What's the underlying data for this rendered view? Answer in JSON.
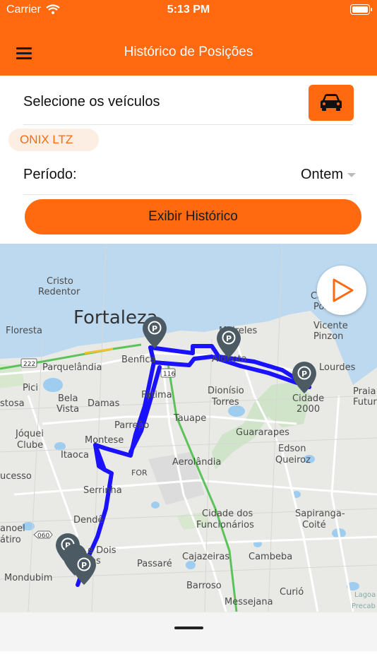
{
  "status_bar": {
    "carrier": "Carrier",
    "time": "5:13 PM"
  },
  "header": {
    "title": "Histórico de Posições",
    "menu_icon": "hamburger-menu-icon",
    "color": "#ff6a10"
  },
  "vehicles": {
    "label": "Selecione os veículos",
    "button_icon": "car-icon",
    "selected_chip": "ONIX LTZ"
  },
  "period": {
    "label": "Período:",
    "value": "Ontem"
  },
  "action": {
    "label": "Exibir Histórico"
  },
  "map": {
    "route_color": "#1a12ff",
    "labels": {
      "cristo_redentor": [
        "Cristo",
        "Redentor"
      ],
      "fortaleza": "Fortaleza",
      "floresta": "Floresta",
      "parquelandia": "Parquelândia",
      "benfica": "Benfica",
      "meireles": "Meireles",
      "aldeota": "Aldeota",
      "cais_porto": [
        "Cais do",
        "Porto"
      ],
      "vicente_pinzon": [
        "Vicente",
        "Pinzon"
      ],
      "de_lourdes": "Lourdes",
      "praia_futuro": [
        "Praia",
        "Futur"
      ],
      "pici": "Pici",
      "bela_vista": [
        "Bela",
        "Vista"
      ],
      "damas": "Damas",
      "fatima": "Fátima",
      "dionisio_torres": [
        "Dionísio",
        "Torres"
      ],
      "cidade_2000": [
        "Cidade",
        "2000"
      ],
      "costa": "stosa",
      "joquei_clube": [
        "Jóquei",
        "Clube"
      ],
      "parreao": "Parreão",
      "tauape": "Tauape",
      "guararapes": "Guararapes",
      "montese": "Montese",
      "edson_queiroz": [
        "Edson",
        "Queiroz"
      ],
      "itaoca": "Itaoca",
      "aerolandia": "Aerolândia",
      "sucesso": "ucesso",
      "for": "FOR",
      "serrinha": "Serrinha",
      "dende": "Dendê",
      "cidade_funcionarios": [
        "Cidade dos",
        "Funcionários"
      ],
      "sapiranga_coite": [
        "Sapiranga-",
        "Coité"
      ],
      "manoel_satiro": [
        "anoel",
        "átiro"
      ],
      "dois_irmaos": [
        "e Dois",
        "os"
      ],
      "passare": "Passaré",
      "cajazeiras": "Cajazeiras",
      "cambeba": "Cambeba",
      "mondubim": "Mondubim",
      "barroso": "Barroso",
      "curio": "Curió",
      "messejana": "Messejana",
      "lagoa_precab": [
        "Lagoa",
        "Precab"
      ],
      "shield_222": "222",
      "shield_116": "116",
      "shield_060": "060"
    },
    "markers": [
      "parking-marker-benfica",
      "parking-marker-aldeota",
      "parking-marker-cidade-2000",
      "parking-marker-mondubim-1",
      "parking-marker-mondubim-2",
      "parking-marker-mondubim-3"
    ],
    "play_icon": "play-icon"
  },
  "sheet": {
    "handle": "drag-handle"
  }
}
